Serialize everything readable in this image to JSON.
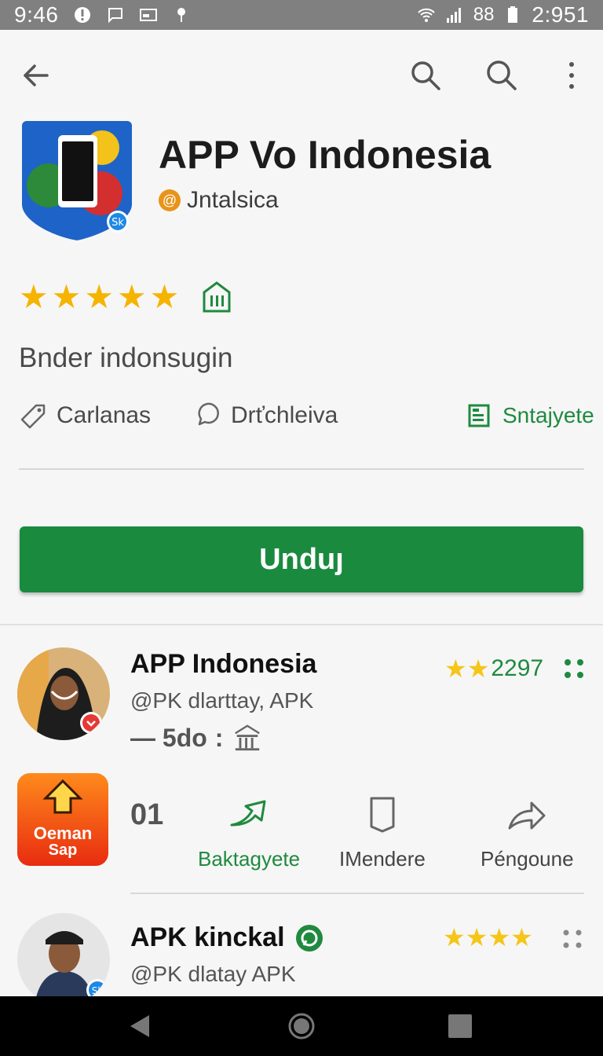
{
  "status_bar": {
    "time_left": "9:46",
    "time_right": "2:951",
    "network_label": "88"
  },
  "app_bar": {
    "back_icon": "arrow-left-icon",
    "search_icon": "search-icon",
    "more_icon": "more-vert-icon"
  },
  "app": {
    "title": "APP Vo Indonesia",
    "developer": "Jntalsica",
    "developer_badge": "@",
    "icon_badge": "Sk",
    "rating_stars": 5,
    "subtitle": "Bnder indonsugin",
    "chips": [
      {
        "label": "Carlanas",
        "icon": "tag-icon"
      },
      {
        "label": "Drťchleiva",
        "icon": "chat-bubble-icon"
      },
      {
        "label": "Sntajyete",
        "icon": "book-icon"
      }
    ],
    "download_label": "Unduȷ"
  },
  "list": [
    {
      "title": "APP Indonesia",
      "subtitle": "@PK dlarttay, APK",
      "rating_text": "2297",
      "stars": 2,
      "meta_text": "— 5do",
      "meta_separator": ":"
    },
    {
      "title": "APK kinckal",
      "subtitle": "@PK dlatay APK",
      "stars": 4,
      "avatar_badge": "Sk"
    }
  ],
  "promo": {
    "icon_text_line1": "Oeman",
    "icon_text_line2": "Sap",
    "number": "01",
    "actions": [
      {
        "label": "Baktagyete",
        "icon": "share-arrow-icon"
      },
      {
        "label": "IMendere",
        "icon": "bookmark-icon"
      },
      {
        "label": "Péngoune",
        "icon": "forward-icon"
      }
    ]
  },
  "colors": {
    "accent_green": "#1a8a3f",
    "star_gold": "#f5b400",
    "status_bar": "#808080"
  }
}
